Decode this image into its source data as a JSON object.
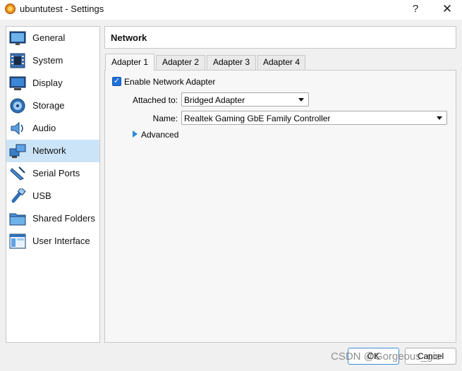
{
  "window": {
    "title": "ubuntutest - Settings",
    "help_label": "?",
    "close_label": "✕"
  },
  "sidebar": {
    "items": [
      {
        "label": "General",
        "icon": "general-icon"
      },
      {
        "label": "System",
        "icon": "system-icon"
      },
      {
        "label": "Display",
        "icon": "display-icon"
      },
      {
        "label": "Storage",
        "icon": "storage-icon"
      },
      {
        "label": "Audio",
        "icon": "audio-icon"
      },
      {
        "label": "Network",
        "icon": "network-icon",
        "selected": true
      },
      {
        "label": "Serial Ports",
        "icon": "serial-ports-icon"
      },
      {
        "label": "USB",
        "icon": "usb-icon"
      },
      {
        "label": "Shared Folders",
        "icon": "shared-folders-icon"
      },
      {
        "label": "User Interface",
        "icon": "user-interface-icon"
      }
    ]
  },
  "section": {
    "title": "Network"
  },
  "tabs": [
    {
      "label": "Adapter 1",
      "active": true
    },
    {
      "label": "Adapter 2"
    },
    {
      "label": "Adapter 3"
    },
    {
      "label": "Adapter 4"
    }
  ],
  "adapter": {
    "enable_label": "Enable Network Adapter",
    "enabled": true,
    "checkmark": "✓",
    "attached_label": "Attached to:",
    "attached_value": "Bridged Adapter",
    "name_label": "Name:",
    "name_value": "Realtek Gaming GbE Family Controller",
    "advanced_label": "Advanced"
  },
  "buttons": {
    "ok_label": "OK",
    "cancel_label": "Cancel"
  },
  "watermark": "CSDN @Gorgeous_gic",
  "colors": {
    "selection": "#cce4f7",
    "accent": "#1e6fd9"
  }
}
